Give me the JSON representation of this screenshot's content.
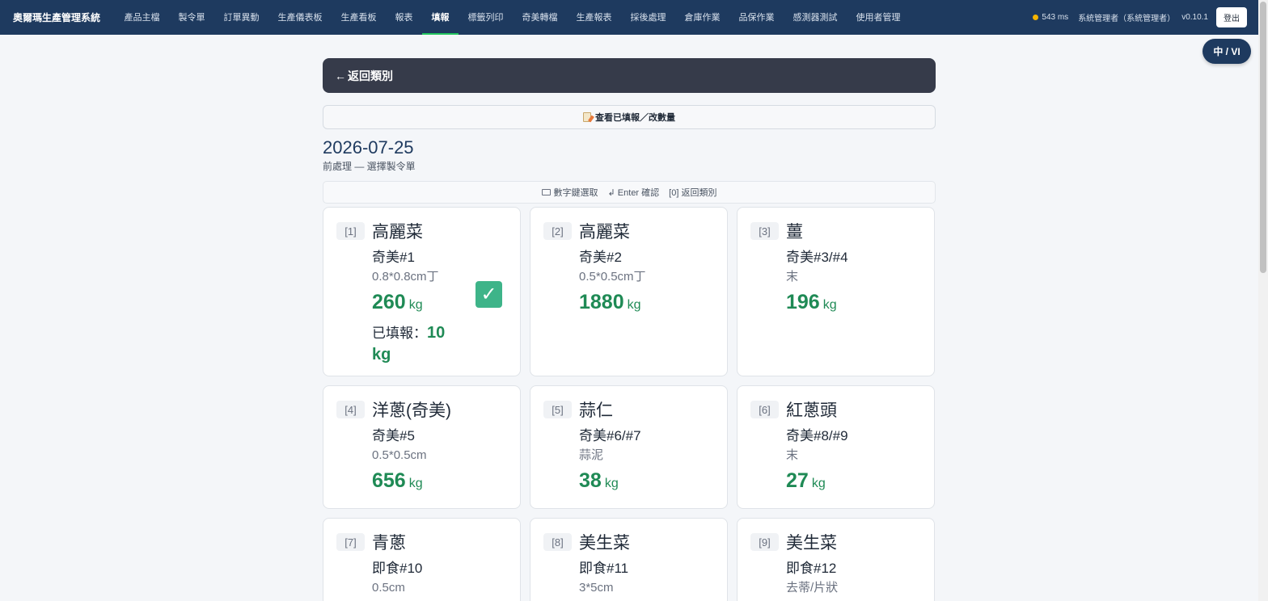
{
  "app": {
    "title": "奧爾瑪生產管理系統"
  },
  "nav": {
    "items": [
      {
        "label": "產品主檔",
        "active": false
      },
      {
        "label": "製令單",
        "active": false
      },
      {
        "label": "訂單異動",
        "active": false
      },
      {
        "label": "生產儀表板",
        "active": false
      },
      {
        "label": "生產看板",
        "active": false
      },
      {
        "label": "報表",
        "active": false
      },
      {
        "label": "填報",
        "active": true
      },
      {
        "label": "標籤列印",
        "active": false
      },
      {
        "label": "奇美轉檔",
        "active": false
      },
      {
        "label": "生產報表",
        "active": false
      },
      {
        "label": "採後處理",
        "active": false
      },
      {
        "label": "倉庫作業",
        "active": false
      },
      {
        "label": "品保作業",
        "active": false
      },
      {
        "label": "感測器測試",
        "active": false
      },
      {
        "label": "使用者管理",
        "active": false
      }
    ],
    "latency": "543 ms",
    "user": "系統管理者（系統管理者）",
    "version": "v0.10.1",
    "logout": "登出"
  },
  "lang_toggle": "中 / VI",
  "back": {
    "arrow": "←",
    "label": "返回類別"
  },
  "view_filled": "查看已填報／改數量",
  "date": "2026-07-25",
  "subtitle": "前處理 — 選擇製令單",
  "hints": {
    "numeric": "數字鍵選取",
    "enter": "↲ Enter 確認",
    "back": "[0] 返回類別"
  },
  "cards": [
    {
      "key": "[1]",
      "name": "高麗菜",
      "order": "奇美#1",
      "spec": "0.8*0.8cm丁",
      "qty": "260",
      "unit": "kg",
      "filled_label": "已填報：",
      "filled_value": "10 kg",
      "checked": true
    },
    {
      "key": "[2]",
      "name": "高麗菜",
      "order": "奇美#2",
      "spec": "0.5*0.5cm丁",
      "qty": "1880",
      "unit": "kg"
    },
    {
      "key": "[3]",
      "name": "薑",
      "order": "奇美#3/#4",
      "spec": "末",
      "qty": "196",
      "unit": "kg"
    },
    {
      "key": "[4]",
      "name": "洋蔥(奇美)",
      "order": "奇美#5",
      "spec": "0.5*0.5cm",
      "qty": "656",
      "unit": "kg"
    },
    {
      "key": "[5]",
      "name": "蒜仁",
      "order": "奇美#6/#7",
      "spec": "蒜泥",
      "qty": "38",
      "unit": "kg"
    },
    {
      "key": "[6]",
      "name": "紅蔥頭",
      "order": "奇美#8/#9",
      "spec": "末",
      "qty": "27",
      "unit": "kg"
    },
    {
      "key": "[7]",
      "name": "青蔥",
      "order": "即食#10",
      "spec": "0.5cm"
    },
    {
      "key": "[8]",
      "name": "美生菜",
      "order": "即食#11",
      "spec": "3*5cm"
    },
    {
      "key": "[9]",
      "name": "美生菜",
      "order": "即食#12",
      "spec": "去蒂/片狀"
    }
  ],
  "colors": {
    "nav_bg": "#1e3a5f",
    "accent_green": "#1f8a55",
    "back_bar": "#363b4a",
    "active_underline": "#22c55e",
    "status_dot": "#f5b400"
  }
}
